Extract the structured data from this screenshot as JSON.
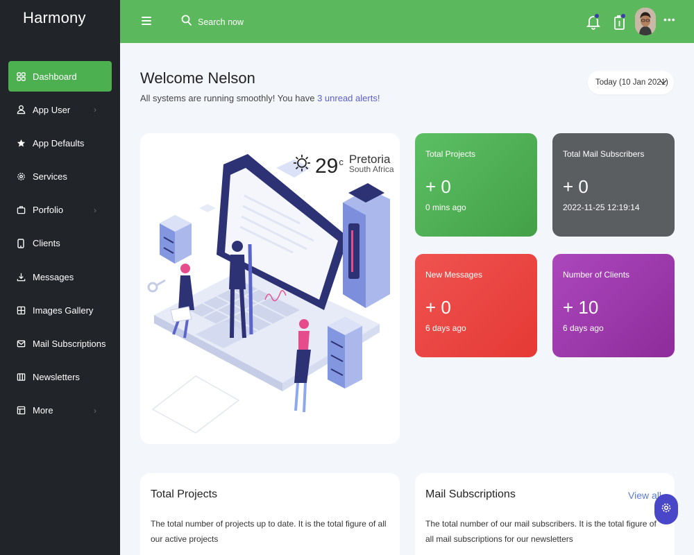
{
  "app": {
    "brand": "Harmony"
  },
  "sidebar": {
    "items": [
      {
        "label": "Dashboard",
        "icon": "grid-icon",
        "active": true
      },
      {
        "label": "App User",
        "icon": "user-icon",
        "chevron": true
      },
      {
        "label": "App Defaults",
        "icon": "star-icon"
      },
      {
        "label": "Services",
        "icon": "gear-icon"
      },
      {
        "label": "Porfolio",
        "icon": "briefcase-icon",
        "chevron": true
      },
      {
        "label": "Clients",
        "icon": "phone-icon"
      },
      {
        "label": "Messages",
        "icon": "download-icon"
      },
      {
        "label": "Images Gallery",
        "icon": "gallery-icon"
      },
      {
        "label": "Mail Subscriptions",
        "icon": "mail-icon"
      },
      {
        "label": "Newsletters",
        "icon": "columns-icon"
      },
      {
        "label": "More",
        "icon": "layout-icon",
        "chevron": true
      }
    ]
  },
  "topbar": {
    "search_placeholder": "Search now",
    "accent": "#5cb85c"
  },
  "welcome": {
    "title": "Welcome Nelson",
    "subtitle_prefix": "All systems are running smoothly! You have ",
    "alert_link": "3 unread alerts!",
    "date_label": "Today (10 Jan 2021)"
  },
  "weather": {
    "temp": "29",
    "unit": "c",
    "city": "Pretoria",
    "country": "South Africa"
  },
  "stats": [
    {
      "title": "Total Projects",
      "value": "+ 0",
      "time": "0 mins ago",
      "color": "#4caf50"
    },
    {
      "title": "Total Mail Subscribers",
      "value": "+ 0",
      "time": "2022-11-25 12:19:14",
      "color": "#5a5e61"
    },
    {
      "title": "New Messages",
      "value": "+ 0",
      "time": "6 days ago",
      "color": "#e53935"
    },
    {
      "title": "Number of Clients",
      "value": "+ 10",
      "time": "6 days ago",
      "color": "#9c27b0"
    }
  ],
  "info_cards": {
    "projects": {
      "title": "Total Projects",
      "text": "The total number of projects up to date. It is the total figure of all our active projects"
    },
    "mail": {
      "title": "Mail Subscriptions",
      "link": "View all",
      "text": "The total number of our mail subscribers. It is the total figure of all mail subscriptions for our newsletters"
    }
  }
}
